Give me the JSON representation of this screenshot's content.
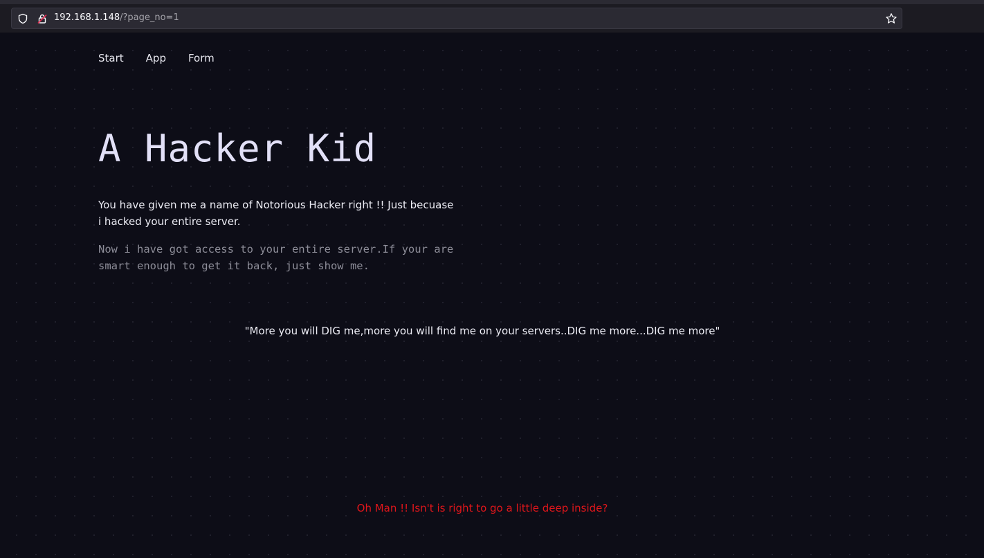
{
  "browser": {
    "url_host": "192.168.1.148",
    "url_path": "/?page_no=1",
    "icons": [
      "shield-icon",
      "insecure-lock-icon",
      "star-icon"
    ]
  },
  "nav": {
    "items": [
      {
        "label": "Start"
      },
      {
        "label": "App"
      },
      {
        "label": "Form"
      }
    ]
  },
  "main": {
    "title": "A Hacker Kid",
    "intro": "You have given me a name of Notorious Hacker right !! Just becuase i hacked your entire server.",
    "message": "Now i have got access to your entire server.If your are smart enough to get it back, just show me.",
    "quote": "\"More you will DIG me,more you will find me on your servers..DIG me more...DIG me more\"",
    "hint": "Oh Man !! Isn't is right to go a little deep inside?"
  },
  "colors": {
    "background": "#0d0d17",
    "hint_red": "#e0161b",
    "title": "#e2e0f7"
  }
}
